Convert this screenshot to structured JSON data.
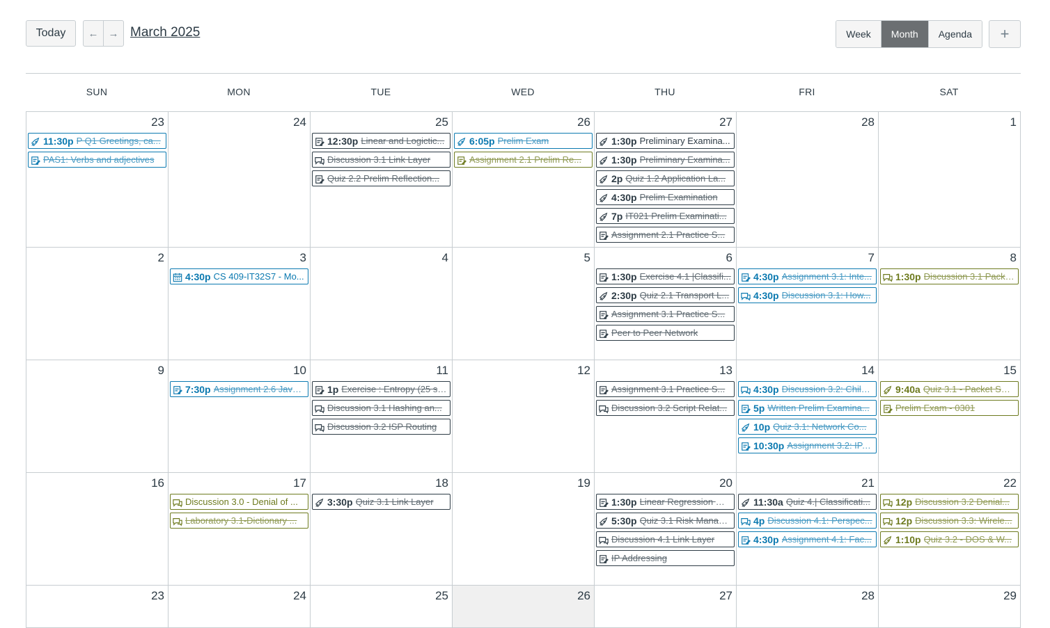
{
  "header": {
    "today_label": "Today",
    "prev_icon": "←",
    "next_icon": "→",
    "month_title": "March 2025",
    "views": [
      "Week",
      "Month",
      "Agenda"
    ],
    "active_view": "Month",
    "add_icon": "+"
  },
  "colors": {
    "gray": "#2d3b45",
    "blue": "#0b79b0",
    "olive": "#6d7a1e",
    "accent_active": "#6b6f72"
  },
  "weekdays": [
    "SUN",
    "MON",
    "TUE",
    "WED",
    "THU",
    "FRI",
    "SAT"
  ],
  "weeks": [
    {
      "days": [
        {
          "num": "23",
          "events": [
            {
              "icon": "quiz-icon",
              "color": "blue",
              "time": "11:30p",
              "title": "P Q1 Greetings, ca...",
              "done": true
            },
            {
              "icon": "assignment-icon",
              "color": "blue",
              "time": "",
              "title": "PAS1: Verbs and adjectives",
              "done": true
            }
          ]
        },
        {
          "num": "24",
          "events": []
        },
        {
          "num": "25",
          "events": [
            {
              "icon": "assignment-icon",
              "color": "gray",
              "time": "12:30p",
              "title": "Linear and Logictic...",
              "done": true
            },
            {
              "icon": "discussion-icon",
              "color": "gray",
              "time": "",
              "title": "Discussion 3.1 Link Layer",
              "done": true
            },
            {
              "icon": "assignment-icon",
              "color": "gray",
              "time": "",
              "title": "Quiz 2.2 Prelim Reflection...",
              "done": true
            }
          ]
        },
        {
          "num": "26",
          "events": [
            {
              "icon": "quiz-icon",
              "color": "blue",
              "time": "6:05p",
              "title": "Prelim Exam",
              "done": true
            },
            {
              "icon": "assignment-icon",
              "color": "olive",
              "time": "",
              "title": "Assignment 2.1 Prelim Re...",
              "done": true
            }
          ]
        },
        {
          "num": "27",
          "events": [
            {
              "icon": "quiz-icon",
              "color": "gray",
              "time": "1:30p",
              "title": "Preliminary Examina...",
              "done": false
            },
            {
              "icon": "quiz-icon",
              "color": "gray",
              "time": "1:30p",
              "title": "Preliminary Examina...",
              "done": true
            },
            {
              "icon": "quiz-icon",
              "color": "gray",
              "time": "2p",
              "title": "Quiz 1.2 Application La...",
              "done": true
            },
            {
              "icon": "quiz-icon",
              "color": "gray",
              "time": "4:30p",
              "title": "Prelim Examination",
              "done": true
            },
            {
              "icon": "quiz-icon",
              "color": "gray",
              "time": "7p",
              "title": "IT021 Prelim Examinati...",
              "done": true
            },
            {
              "icon": "assignment-icon",
              "color": "gray",
              "time": "",
              "title": "Assignment 2.1 Practice S...",
              "done": true
            }
          ]
        },
        {
          "num": "28",
          "events": []
        },
        {
          "num": "1",
          "events": []
        }
      ]
    },
    {
      "days": [
        {
          "num": "2",
          "events": []
        },
        {
          "num": "3",
          "events": [
            {
              "icon": "calendar-icon",
              "color": "blue",
              "time": "4:30p",
              "title": "CS 409-IT32S7 - Mo...",
              "done": false
            }
          ]
        },
        {
          "num": "4",
          "events": []
        },
        {
          "num": "5",
          "events": []
        },
        {
          "num": "6",
          "events": [
            {
              "icon": "assignment-icon",
              "color": "gray",
              "time": "1:30p",
              "title": "Exercise 4.1 |Classifi...",
              "done": true
            },
            {
              "icon": "quiz-icon",
              "color": "gray",
              "time": "2:30p",
              "title": "Quiz 2.1 Transport L...",
              "done": true
            },
            {
              "icon": "assignment-icon",
              "color": "gray",
              "time": "",
              "title": "Assignment 3.1 Practice S...",
              "done": true
            },
            {
              "icon": "assignment-icon",
              "color": "gray",
              "time": "",
              "title": "Peer to Peer Network",
              "done": true
            }
          ]
        },
        {
          "num": "7",
          "events": [
            {
              "icon": "assignment-icon",
              "color": "blue",
              "time": "4:30p",
              "title": "Assignment 3.1: Inte...",
              "done": true
            },
            {
              "icon": "discussion-icon",
              "color": "blue",
              "time": "4:30p",
              "title": "Discussion 3.1: How...",
              "done": true
            }
          ]
        },
        {
          "num": "8",
          "events": [
            {
              "icon": "discussion-icon",
              "color": "olive",
              "time": "1:30p",
              "title": "Discussion 3.1 Packe...",
              "done": true
            }
          ]
        }
      ]
    },
    {
      "days": [
        {
          "num": "9",
          "events": []
        },
        {
          "num": "10",
          "events": [
            {
              "icon": "assignment-icon",
              "color": "blue",
              "time": "7:30p",
              "title": "Assignment 2.6 Java...",
              "done": true
            }
          ]
        },
        {
          "num": "11",
          "events": [
            {
              "icon": "assignment-icon",
              "color": "gray",
              "time": "1p",
              "title": "Exercise : Entropy (25 st...",
              "done": true
            },
            {
              "icon": "discussion-icon",
              "color": "gray",
              "time": "",
              "title": "Discussion 3.1 Hashing an...",
              "done": true
            },
            {
              "icon": "discussion-icon",
              "color": "gray",
              "time": "",
              "title": "Discussion 3.2 ISP Routing",
              "done": true
            }
          ]
        },
        {
          "num": "12",
          "events": []
        },
        {
          "num": "13",
          "events": [
            {
              "icon": "assignment-icon",
              "color": "gray",
              "time": "",
              "title": "Assignment 3.1 Practice S...",
              "done": true
            },
            {
              "icon": "discussion-icon",
              "color": "gray",
              "time": "",
              "title": "Discussion 3.2 Script Relat...",
              "done": true
            }
          ]
        },
        {
          "num": "14",
          "events": [
            {
              "icon": "discussion-icon",
              "color": "blue",
              "time": "4:30p",
              "title": "Discussion 3.2: Child...",
              "done": true
            },
            {
              "icon": "assignment-icon",
              "color": "blue",
              "time": "5p",
              "title": "Written Prelim Examina...",
              "done": true
            },
            {
              "icon": "quiz-icon",
              "color": "blue",
              "time": "10p",
              "title": "Quiz 3.1: Network Co...",
              "done": true
            },
            {
              "icon": "assignment-icon",
              "color": "blue",
              "time": "10:30p",
              "title": "Assignment 3.2: IP, ...",
              "done": true
            }
          ]
        },
        {
          "num": "15",
          "events": [
            {
              "icon": "quiz-icon",
              "color": "olive",
              "time": "9:40a",
              "title": "Quiz 3.1 - Packet Sni...",
              "done": true
            },
            {
              "icon": "assignment-icon",
              "color": "olive",
              "time": "",
              "title": "Prelim Exam - 0301",
              "done": true
            }
          ]
        }
      ]
    },
    {
      "days": [
        {
          "num": "16",
          "events": []
        },
        {
          "num": "17",
          "events": [
            {
              "icon": "discussion-icon",
              "color": "olive",
              "time": "",
              "title": "Discussion 3.0 - Denial of ...",
              "done": false
            },
            {
              "icon": "discussion-icon",
              "color": "olive",
              "time": "",
              "title": "Laboratory 3.1-Dictionary ...",
              "done": true
            }
          ]
        },
        {
          "num": "18",
          "events": [
            {
              "icon": "quiz-icon",
              "color": "gray",
              "time": "3:30p",
              "title": "Quiz 3.1 Link Layer",
              "done": true
            }
          ]
        },
        {
          "num": "19",
          "events": []
        },
        {
          "num": "20",
          "events": [
            {
              "icon": "assignment-icon",
              "color": "gray",
              "time": "1:30p",
              "title": "Linear Regression Us...",
              "done": true
            },
            {
              "icon": "quiz-icon",
              "color": "gray",
              "time": "5:30p",
              "title": "Quiz 3.1 Risk Manag...",
              "done": true
            },
            {
              "icon": "discussion-icon",
              "color": "gray",
              "time": "",
              "title": "Discussion 4.1 Link Layer",
              "done": true
            },
            {
              "icon": "assignment-icon",
              "color": "gray",
              "time": "",
              "title": "IP Addressing",
              "done": true
            }
          ]
        },
        {
          "num": "21",
          "events": [
            {
              "icon": "quiz-icon",
              "color": "gray",
              "time": "11:30a",
              "title": "Quiz 4.| Classificati...",
              "done": true
            },
            {
              "icon": "discussion-icon",
              "color": "blue",
              "time": "4p",
              "title": "Discussion 4.1: Perspec...",
              "done": true
            },
            {
              "icon": "assignment-icon",
              "color": "blue",
              "time": "4:30p",
              "title": "Assignment 4.1: Fac...",
              "done": true
            }
          ]
        },
        {
          "num": "22",
          "events": [
            {
              "icon": "discussion-icon",
              "color": "olive",
              "time": "12p",
              "title": "Discussion 3.2 Denial...",
              "done": true
            },
            {
              "icon": "discussion-icon",
              "color": "olive",
              "time": "12p",
              "title": "Discussion 3.3: Wirele...",
              "done": true
            },
            {
              "icon": "quiz-icon",
              "color": "olive",
              "time": "1:10p",
              "title": "Quiz 3.2 - DOS & W...",
              "done": true
            }
          ]
        }
      ]
    },
    {
      "days": [
        {
          "num": "23",
          "events": []
        },
        {
          "num": "24",
          "events": []
        },
        {
          "num": "25",
          "events": []
        },
        {
          "num": "26",
          "events": [],
          "today": true
        },
        {
          "num": "27",
          "events": []
        },
        {
          "num": "28",
          "events": []
        },
        {
          "num": "29",
          "events": []
        }
      ]
    }
  ]
}
